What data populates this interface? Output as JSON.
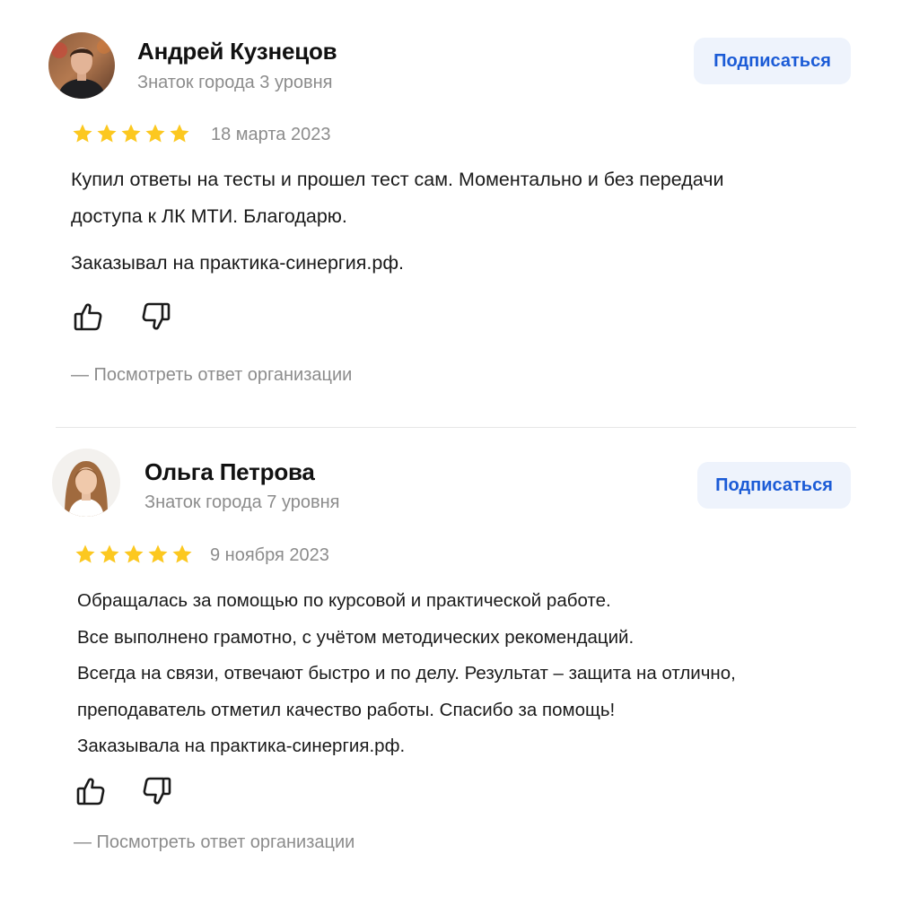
{
  "reviews": [
    {
      "author": "Андрей Кузнецов",
      "level": "Знаток города 3 уровня",
      "subscribe_label": "Подписаться",
      "rating": 5,
      "date": "18 марта 2023",
      "text": [
        "Купил ответы на тесты и прошел тест сам. Моментально и без передачи",
        "доступа к ЛК МТИ. Благодарю.",
        "Заказывал на практика-синергия.рф."
      ],
      "org_reply_label": "— Посмотреть ответ организации"
    },
    {
      "author": "Ольга Петрова",
      "level": "Знаток города 7 уровня",
      "subscribe_label": "Подписаться",
      "rating": 5,
      "date": "9 ноября 2023",
      "text": [
        "Обращалась за помощью по курсовой и практической работе.",
        "Все выполнено грамотно, с учётом методических рекомендаций.",
        "Всегда на связи, отвечают быстро и по делу. Результат – защита на отлично,",
        "преподаватель отметил качество работы. Спасибо за помощь!",
        "Заказывала на практика-синергия.рф."
      ],
      "org_reply_label": "— Посмотреть ответ организации"
    }
  ],
  "colors": {
    "star": "#fcc820",
    "accent": "#1b5bd6",
    "button_bg": "#eef3fc",
    "muted_text": "#8c8c8c"
  },
  "icons": [
    "star-icon",
    "thumbs-up-icon",
    "thumbs-down-icon",
    "avatar"
  ]
}
